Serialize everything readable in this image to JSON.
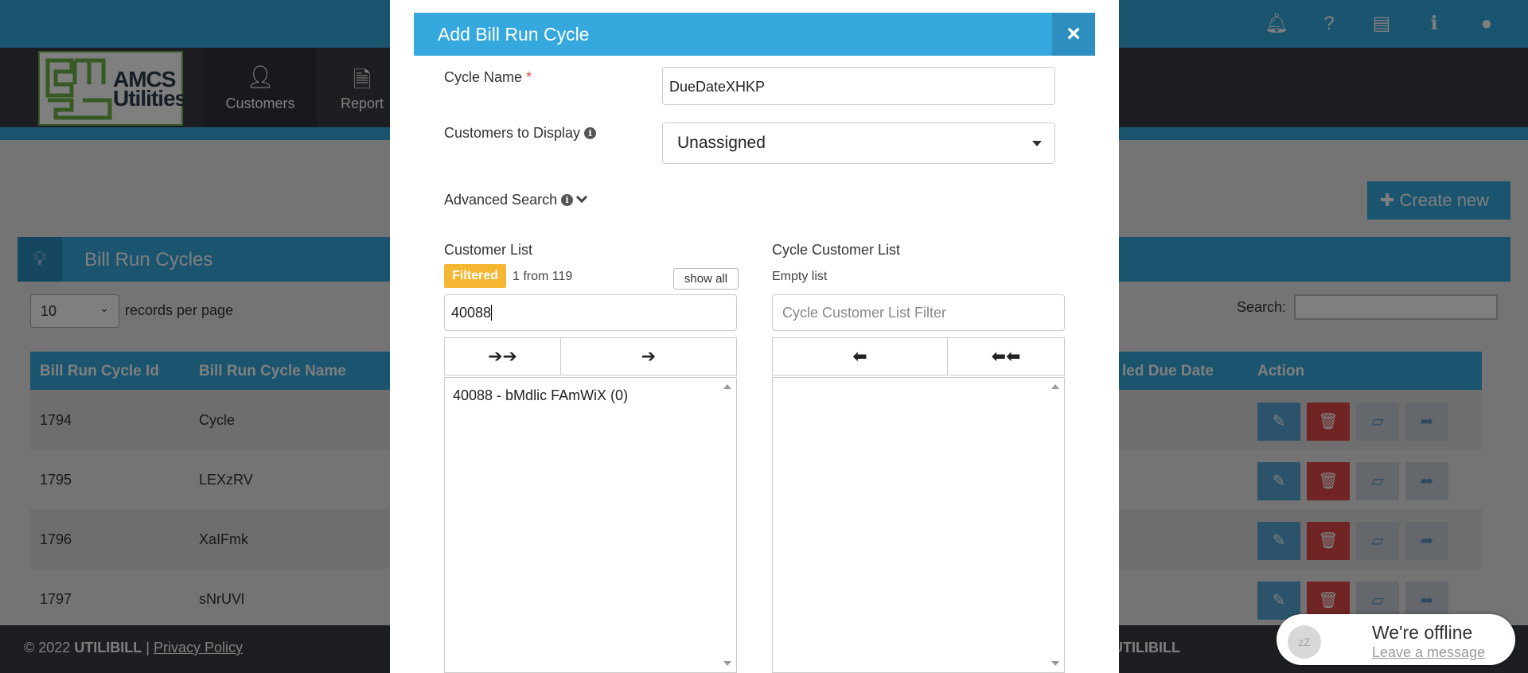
{
  "header": {
    "icons": [
      "bell-icon",
      "question-icon",
      "card-icon",
      "info-icon",
      "user-icon"
    ]
  },
  "logo": {
    "line1": "AMCS",
    "line2": "Utilities"
  },
  "nav": {
    "customers": "Customers",
    "reports": "Report"
  },
  "page": {
    "create_new": "Create new",
    "panel_title": "Bill Run Cycles",
    "records_per_page_value": "10",
    "records_per_page_label": "records per page",
    "search_label": "Search:"
  },
  "table": {
    "columns": [
      "Bill Run Cycle Id",
      "Bill Run Cycle Name",
      "led Due Date",
      "Action"
    ],
    "rows": [
      {
        "id": "1794",
        "name": "Cycle"
      },
      {
        "id": "1795",
        "name": "LEXzRV"
      },
      {
        "id": "1796",
        "name": "XaIFmk"
      },
      {
        "id": "1797",
        "name": "sNrUVl"
      }
    ]
  },
  "footer": {
    "copyright": "© 2022 ",
    "brand": "UTILIBILL",
    "separator": " | ",
    "privacy": "Privacy Policy",
    "right_brand": "UTILIBILL"
  },
  "modal": {
    "title": "Add Bill Run Cycle",
    "close": "×",
    "cycle_name_label": "Cycle Name",
    "required_mark": "*",
    "cycle_name_value": "DueDateXHKP",
    "customers_to_display_label": "Customers to Display",
    "customers_to_display_value": "Unassigned",
    "advanced_search_label": "Advanced Search",
    "customer_list_label": "Customer List",
    "filtered_badge": "Filtered",
    "filtered_count": "1 from 119",
    "show_all": "show all",
    "filter_value": "40088",
    "cycle_customer_list_label": "Cycle Customer List",
    "empty_list": "Empty list",
    "cycle_filter_placeholder": "Cycle Customer List Filter",
    "move_all_right": "➔➔",
    "move_right": "➔",
    "move_left": "⬅",
    "move_all_left": "⬅⬅",
    "customer_items": [
      "40088 - bMdlic FAmWiX (0)"
    ]
  },
  "chat": {
    "title": "We're offline",
    "link": "Leave a message"
  },
  "colors": {
    "accent": "#35a8dd",
    "danger": "#e14848",
    "warning": "#f5b731",
    "nav_dark": "#393d45"
  }
}
